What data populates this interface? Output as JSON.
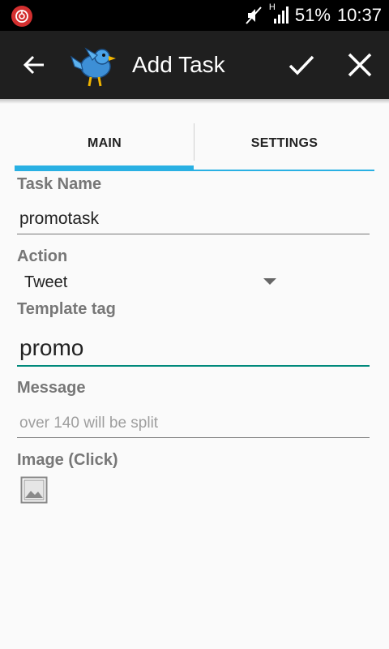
{
  "status_bar": {
    "signal_label": "H",
    "battery": "51%",
    "time": "10:37"
  },
  "app_bar": {
    "title": "Add Task"
  },
  "tabs": [
    {
      "label": "MAIN",
      "selected": true
    },
    {
      "label": "SETTINGS",
      "selected": false
    }
  ],
  "form": {
    "task_name": {
      "label": "Task Name",
      "value": "promotask"
    },
    "action": {
      "label": "Action",
      "value": "Tweet"
    },
    "template_tag": {
      "label": "Template tag",
      "value": "promo"
    },
    "message": {
      "label": "Message",
      "placeholder": "over 140 will be split"
    },
    "image": {
      "label": "Image (Click)"
    }
  },
  "colors": {
    "accent": "#29b0e3",
    "focus_underline": "#00897b",
    "app_bar": "#1f1f1f"
  }
}
